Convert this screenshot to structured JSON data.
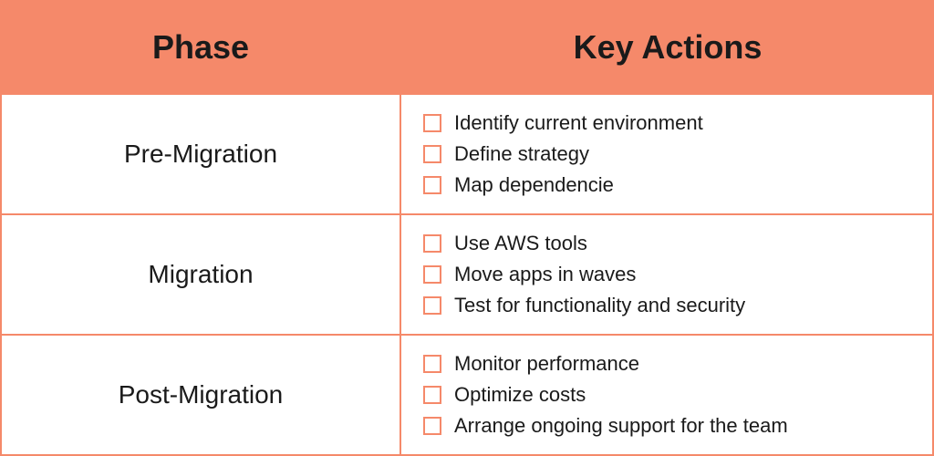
{
  "chart_data": {
    "type": "table",
    "columns": [
      "Phase",
      "Key Actions"
    ],
    "rows": [
      {
        "phase": "Pre-Migration",
        "actions": [
          "Identify current environment",
          "Define strategy",
          "Map dependencie"
        ]
      },
      {
        "phase": "Migration",
        "actions": [
          "Use AWS tools",
          "Move apps in waves",
          "Test for functionality and security"
        ]
      },
      {
        "phase": "Post-Migration",
        "actions": [
          "Monitor performance",
          "Optimize costs",
          "Arrange ongoing support for the team"
        ]
      }
    ]
  },
  "header": {
    "phase_label": "Phase",
    "actions_label": "Key Actions"
  },
  "rows": [
    {
      "phase": "Pre-Migration",
      "actions": [
        "Identify current environment",
        "Define strategy",
        "Map dependencie"
      ]
    },
    {
      "phase": "Migration",
      "actions": [
        "Use AWS tools",
        "Move apps in waves",
        "Test for functionality and security"
      ]
    },
    {
      "phase": "Post-Migration",
      "actions": [
        "Monitor performance",
        "Optimize costs",
        "Arrange ongoing support for the team"
      ]
    }
  ],
  "colors": {
    "accent": "#f5896a",
    "text": "#1a1a1a"
  }
}
